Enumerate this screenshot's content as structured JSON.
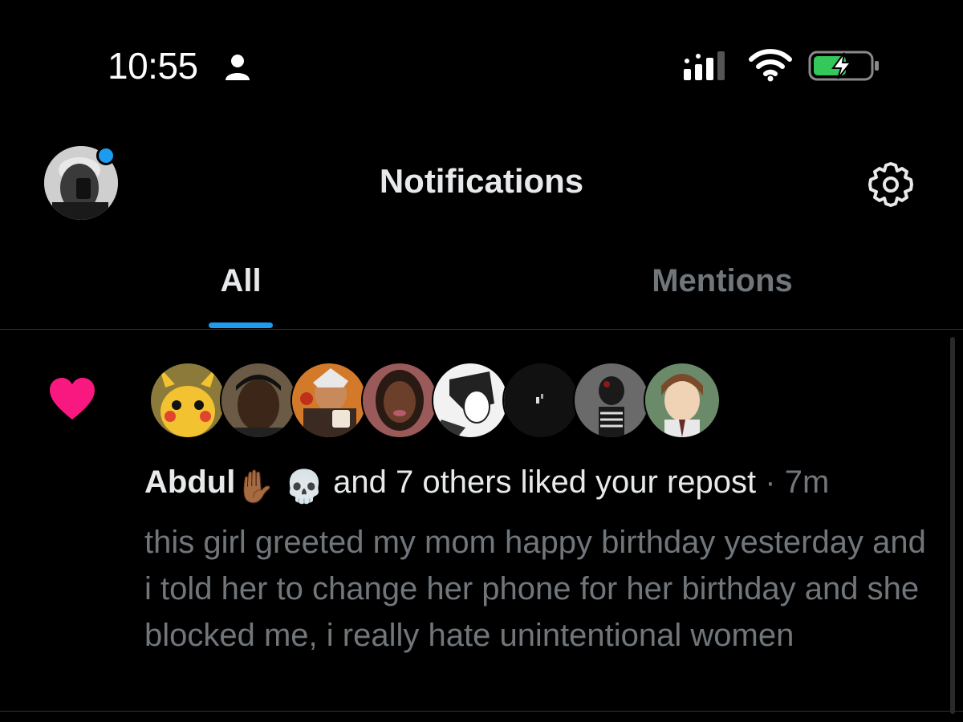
{
  "status_bar": {
    "time": "10:55",
    "icons": [
      "person-icon",
      "signal-icon",
      "wifi-icon",
      "battery-charging-icon"
    ]
  },
  "header": {
    "title": "Notifications",
    "profile_avatar": "profile-avatar",
    "settings_icon": "gear-icon"
  },
  "tabs": [
    {
      "label": "All",
      "selected": true
    },
    {
      "label": "Mentions",
      "selected": false
    }
  ],
  "notification": {
    "icon": "heart-icon",
    "liker_avatars": [
      "pikachu-avatar",
      "man-durag-avatar",
      "anime-gm-avatar",
      "woman-avatar",
      "manga-avatar",
      "dark-avatar",
      "skeleton-avatar",
      "light-yagami-avatar"
    ],
    "actor_name": "Abdul",
    "actor_emojis": "✋🏾 💀",
    "action_text": "and 7 others liked your repost",
    "separator": "·",
    "time_ago": "7m",
    "post_text": "this girl greeted my mom happy birthday yesterday and i told her to change her phone for her birthday and she blocked me, i really hate unintentional women"
  },
  "colors": {
    "background": "#000000",
    "accent": "#1d9bf0",
    "like": "#f91880",
    "primary_text": "#e7e9ea",
    "secondary_text": "#71767b",
    "divider": "#2f3336"
  }
}
